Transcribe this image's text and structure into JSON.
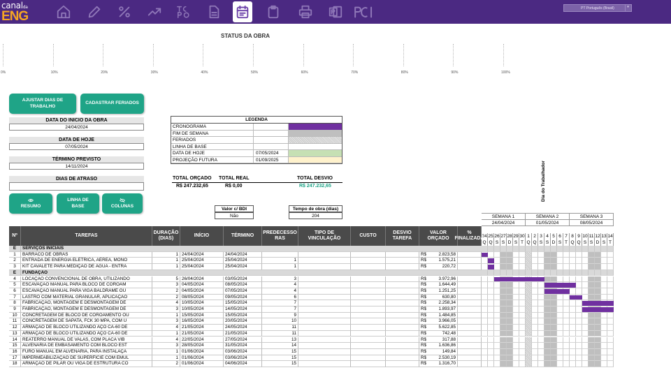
{
  "app": {
    "logo_top": "canal",
    "logo_sub": "da",
    "logo_main": "ENG",
    "language": "PT Português (Brasil)"
  },
  "toolbar": [
    {
      "icon": "home-icon"
    },
    {
      "icon": "pencil-icon"
    },
    {
      "icon": "percent-icon"
    },
    {
      "icon": "trend-icon"
    },
    {
      "icon": "tcpo-icon",
      "text": "TC PO"
    },
    {
      "icon": "document-icon"
    },
    {
      "icon": "calendar-icon",
      "active": true
    },
    {
      "icon": "clipboard-icon"
    },
    {
      "icon": "printer-icon"
    },
    {
      "icon": "powerpoint-icon"
    },
    {
      "icon": "pci-icon",
      "text": "PCI"
    }
  ],
  "status": {
    "title": "STATUS DA OBRA",
    "ticks": [
      "0%",
      "10%",
      "20%",
      "30%",
      "40%",
      "50%",
      "60%",
      "70%",
      "80%",
      "90%",
      "100%"
    ],
    "progress": 0
  },
  "buttons": {
    "ajustar": "AJUSTAR DIAS DE TRABALHO",
    "feriados": "CADASTRAR FERIADOS",
    "resumo": "RESUMO",
    "linha_base": "LINHA DE BASE",
    "colunas": "COLUNAS"
  },
  "fields": {
    "inicio_label": "DATA DO INICIO DA OBRA",
    "inicio_value": "24/04/2024",
    "hoje_label": "DATA DE HOJE",
    "hoje_value": "07/05/2024",
    "termino_label": "TÉRMINO PREVISTO",
    "termino_value": "14/11/2024",
    "atraso_label": "DIAS DE ATRASO",
    "atraso_value": ""
  },
  "legend": {
    "title": "LEGENDA",
    "items": [
      {
        "name": "CRONOGRAMA",
        "date": "",
        "color": "#7030a0"
      },
      {
        "name": "FIM DE SEMANA",
        "date": "",
        "color": "#bfbfbf"
      },
      {
        "name": "FERIADOS",
        "date": "",
        "color": "hatch"
      },
      {
        "name": "LINHA DE BASE",
        "date": "",
        "color": "#ffffff"
      },
      {
        "name": "DATA DE HOJE",
        "date": "07/05/2024",
        "color": "#c6e0b4"
      },
      {
        "name": "PROJEÇÃO FUTURA",
        "date": "01/09/2025",
        "color": "#fff2cc"
      }
    ]
  },
  "totals": {
    "orcado_label": "TOTAL ORÇADO",
    "orcado_value": "R$ 247.232,65",
    "real_label": "TOTAL REAL",
    "real_value": "R$ 0,00",
    "desvio_label": "TOTAL DESVIO",
    "desvio_value": "R$ 247.232,65",
    "desvio_color": "#1fa487"
  },
  "bdi": {
    "label": "Valor c/ BDI",
    "value": "Não"
  },
  "tempo": {
    "label": "Tempo de obra (dias)",
    "value": "204"
  },
  "vertical_label": "Dia do Trabalhador",
  "columns": {
    "n": "Nº",
    "tarefas": "TAREFAS",
    "duracao": "DURAÇÃO (DIAS)",
    "inicio": "INÍCIO",
    "termino": "TÉRMINO",
    "predecessoras": "PREDECESSO RAS",
    "tipo": "TIPO DE VINCULAÇÃO",
    "custo": "CUSTO",
    "desvio": "DESVIO TAREFA",
    "valor": "VALOR ORÇADO",
    "finalizada": "% FINALIZADA"
  },
  "weeks": [
    {
      "name": "SEMANA 1",
      "date": "24/04/2024"
    },
    {
      "name": "SEMANA 2",
      "date": "01/05/2024"
    },
    {
      "name": "SEMANA 3",
      "date": "08/05/2024"
    }
  ],
  "days": [
    {
      "n": "24",
      "d": "Q"
    },
    {
      "n": "25",
      "d": "Q"
    },
    {
      "n": "26",
      "d": "S"
    },
    {
      "n": "27",
      "d": "S"
    },
    {
      "n": "28",
      "d": "D"
    },
    {
      "n": "29",
      "d": "S"
    },
    {
      "n": "30",
      "d": "T"
    },
    {
      "n": "1",
      "d": "Q"
    },
    {
      "n": "2",
      "d": "Q"
    },
    {
      "n": "3",
      "d": "S"
    },
    {
      "n": "4",
      "d": "S"
    },
    {
      "n": "5",
      "d": "D"
    },
    {
      "n": "6",
      "d": "S"
    },
    {
      "n": "7",
      "d": "T"
    },
    {
      "n": "8",
      "d": "Q"
    },
    {
      "n": "9",
      "d": "Q"
    },
    {
      "n": "10",
      "d": "S"
    },
    {
      "n": "11",
      "d": "S"
    },
    {
      "n": "12",
      "d": "D"
    },
    {
      "n": "13",
      "d": "S"
    },
    {
      "n": "14",
      "d": "T"
    }
  ],
  "holidays": [
    7
  ],
  "rows": [
    {
      "cat": true,
      "n": "E",
      "task": "SERVIÇOS INICIAIS"
    },
    {
      "n": "1",
      "task": "BARRACO DE OBRAS",
      "dur": "1",
      "start": "24/04/2024",
      "end": "24/04/2024",
      "pred": "",
      "val": "2.823,58",
      "bar": [
        0,
        1
      ]
    },
    {
      "n": "2",
      "task": "ENTRADA DE ENERGIA ELÉTRICA, AÉREA, MONO",
      "dur": "1",
      "start": "25/04/2024",
      "end": "25/04/2024",
      "pred": "1",
      "val": "1.575,21",
      "bar": [
        1,
        1
      ]
    },
    {
      "n": "3",
      "task": "KIT CAVALETE PARA MEDIÇÃO DE ÁGUA - ENTRA",
      "dur": "1",
      "start": "25/04/2024",
      "end": "25/04/2024",
      "pred": "1",
      "val": "220,72",
      "bar": [
        1,
        1
      ]
    },
    {
      "cat": true,
      "n": "E",
      "task": "FUNDAÇÃO"
    },
    {
      "n": "4",
      "task": "LOCAÇÃO CONVENCIONAL DE OBRA, UTILIZANDO",
      "dur": "5",
      "start": "26/04/2024",
      "end": "03/05/2024",
      "pred": "3",
      "val": "3.972,96",
      "bar": [
        2,
        8
      ]
    },
    {
      "n": "5",
      "task": "ESCAVAÇÃO MANUAL PARA BLOCO DE COROAM",
      "dur": "3",
      "start": "04/05/2024",
      "end": "08/05/2024",
      "pred": "4",
      "val": "1.644,49",
      "bar": [
        10,
        5
      ]
    },
    {
      "n": "6",
      "task": "ESCAVAÇÃO MANUAL PARA VIGA BALDRAME OU",
      "dur": "2",
      "start": "04/05/2024",
      "end": "07/05/2024",
      "pred": "4",
      "val": "1.251,25",
      "bar": [
        10,
        4
      ]
    },
    {
      "n": "7",
      "task": "LASTRO COM MATERIAL GRANULAR, APLICAÇÃO",
      "dur": "2",
      "start": "08/05/2024",
      "end": "09/05/2024",
      "pred": "6",
      "val": "630,80",
      "bar": [
        14,
        2
      ]
    },
    {
      "n": "8",
      "task": "FABRICAÇÃO, MONTAGEM E DESMONTAGEM DE",
      "dur": "4",
      "start": "10/05/2024",
      "end": "15/05/2024",
      "pred": "7",
      "val": "2.258,34",
      "bar": [
        16,
        5
      ]
    },
    {
      "n": "9",
      "task": "FABRICAÇÃO, MONTAGEM E DESMONTAGEM DE",
      "dur": "3",
      "start": "10/05/2024",
      "end": "14/05/2024",
      "pred": "7",
      "val": "1.893,97",
      "bar": [
        16,
        5
      ]
    },
    {
      "n": "10",
      "task": "CONCRETAGEM DE BLOCO DE COROAMENTO OU",
      "dur": "1",
      "start": "15/05/2024",
      "end": "15/05/2024",
      "pred": "9",
      "val": "1.484,85",
      "bar": null
    },
    {
      "n": "11",
      "task": "CONCRETAGEM DE SAPATA, FCK 30 MPA, COM U",
      "dur": "3",
      "start": "16/05/2024",
      "end": "20/05/2024",
      "pred": "10",
      "val": "3.966,05",
      "bar": null
    },
    {
      "n": "12",
      "task": "ARMAÇÃO DE BLOCO UTILIZANDO AÇO CA-60 DE",
      "dur": "4",
      "start": "21/05/2024",
      "end": "24/05/2024",
      "pred": "11",
      "val": "5.622,85",
      "bar": null
    },
    {
      "n": "13",
      "task": "ARMAÇÃO DE BLOCO UTILIZANDO AÇO CA-60 DE",
      "dur": "1",
      "start": "21/05/2024",
      "end": "21/05/2024",
      "pred": "11",
      "val": "742,48",
      "bar": null
    },
    {
      "n": "14",
      "task": "REATERRO MANUAL DE VALAS, COM PLACA VIB",
      "dur": "4",
      "start": "22/05/2024",
      "end": "27/05/2024",
      "pred": "13",
      "val": "317,88",
      "bar": null
    },
    {
      "n": "15",
      "task": "ALVENARIA DE EMBASAMENTO COM BLOCO EST",
      "dur": "3",
      "start": "28/05/2024",
      "end": "31/05/2024",
      "pred": "14",
      "val": "1.636,86",
      "bar": null
    },
    {
      "n": "16",
      "task": "FURO MANUAL EM ALVENARIA, PARA INSTALAÇÃ",
      "dur": "1",
      "start": "01/06/2024",
      "end": "03/06/2024",
      "pred": "15",
      "val": "149,84",
      "bar": null
    },
    {
      "n": "17",
      "task": "IMPERMEABILIZAÇÃO DE SUPERFÍCIE COM EMUL",
      "dur": "1",
      "start": "01/06/2024",
      "end": "03/06/2024",
      "pred": "15",
      "val": "2.530,19",
      "bar": null
    },
    {
      "n": "18",
      "task": "ARMAÇÃO DE PILAR OU VIGA DE ESTRUTURA CO",
      "dur": "2",
      "start": "01/06/2024",
      "end": "04/06/2024",
      "pred": "15",
      "val": "1.316,70",
      "bar": null
    }
  ],
  "currency": "R$"
}
